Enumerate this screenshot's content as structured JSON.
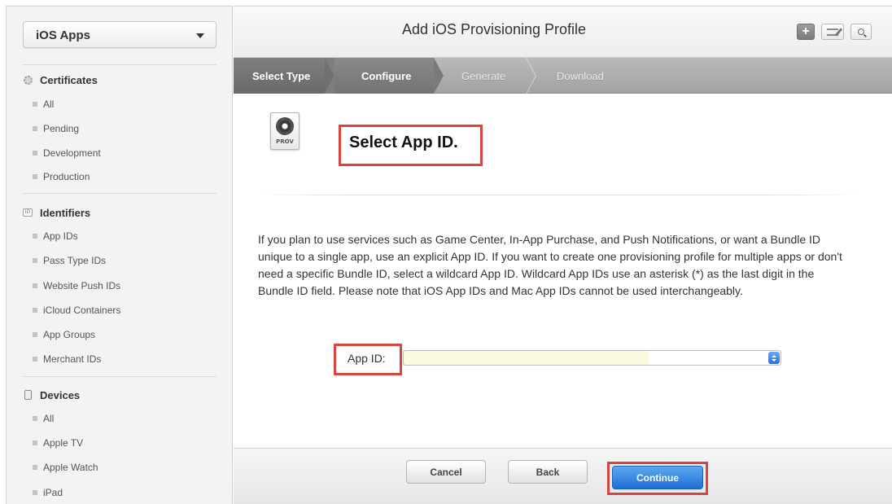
{
  "sidebar": {
    "platform_select": "iOS Apps",
    "sections": [
      {
        "title": "Certificates",
        "icon": "certificate-gear-icon",
        "items": [
          "All",
          "Pending",
          "Development",
          "Production"
        ]
      },
      {
        "title": "Identifiers",
        "icon": "id-badge-icon",
        "icon_text": "ID",
        "items": [
          "App IDs",
          "Pass Type IDs",
          "Website Push IDs",
          "iCloud Containers",
          "App Groups",
          "Merchant IDs"
        ]
      },
      {
        "title": "Devices",
        "icon": "device-icon",
        "items": [
          "All",
          "Apple TV",
          "Apple Watch",
          "iPad"
        ]
      }
    ]
  },
  "header": {
    "title": "Add iOS Provisioning Profile",
    "add_icon": "plus-icon",
    "edit_icon": "edit-icon",
    "search_icon": "search-icon"
  },
  "steps": [
    "Select Type",
    "Configure",
    "Generate",
    "Download"
  ],
  "content": {
    "icon_label": "PROV",
    "heading": "Select App ID.",
    "description": "If you plan to use services such as Game Center, In-App Purchase, and Push Notifications, or want a Bundle ID unique to a single app, use an explicit App ID. If you want to create one provisioning profile for multiple apps or don't need a specific Bundle ID, select a wildcard App ID. Wildcard App IDs use an asterisk (*) as the last digit in the Bundle ID field. Please note that iOS App IDs and Mac App IDs cannot be used interchangeably.",
    "app_id_label": "App ID:",
    "app_id_value": ""
  },
  "footer": {
    "cancel": "Cancel",
    "back": "Back",
    "continue": "Continue"
  },
  "colors": {
    "highlight_box": "#d9443f",
    "continue_button": "#1d6fd5"
  }
}
